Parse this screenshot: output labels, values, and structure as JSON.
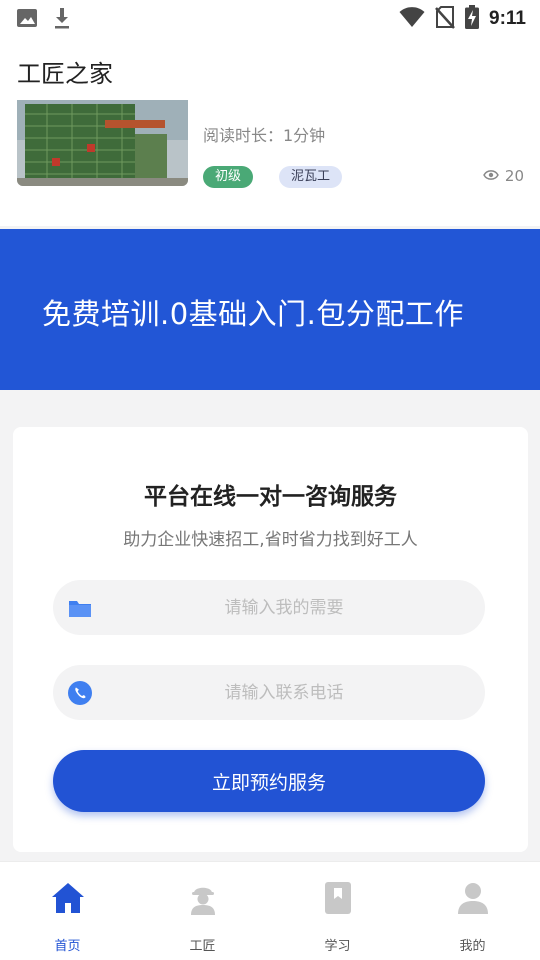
{
  "status_bar": {
    "time": "9:11",
    "icons": [
      "image-icon",
      "download-icon",
      "wifi-icon",
      "no-sim-icon",
      "battery-charging-icon"
    ]
  },
  "header": {
    "title": "工匠之家"
  },
  "article": {
    "read_time": "阅读时长：1分钟",
    "tags": {
      "level": "初级",
      "trade": "泥瓦工"
    },
    "views": "20"
  },
  "banner": {
    "slogan": "免费培训.0基础入门.包分配工作"
  },
  "consult": {
    "title": "平台在线一对一咨询服务",
    "subtitle": "助力企业快速招工,省时省力找到好工人",
    "need_placeholder": "请输入我的需要",
    "phone_placeholder": "请输入联系电话",
    "submit_label": "立即预约服务"
  },
  "nav": {
    "items": [
      {
        "label": "首页",
        "icon": "home-icon"
      },
      {
        "label": "工匠",
        "icon": "worker-icon"
      },
      {
        "label": "学习",
        "icon": "book-icon"
      },
      {
        "label": "我的",
        "icon": "user-icon"
      }
    ],
    "active_index": 0
  },
  "colors": {
    "primary": "#2253d4",
    "banner": "#2256d6",
    "tag_green": "#4aa976",
    "tag_blue_bg": "#dde4f7",
    "inactive_icon": "#c8c8c8"
  }
}
